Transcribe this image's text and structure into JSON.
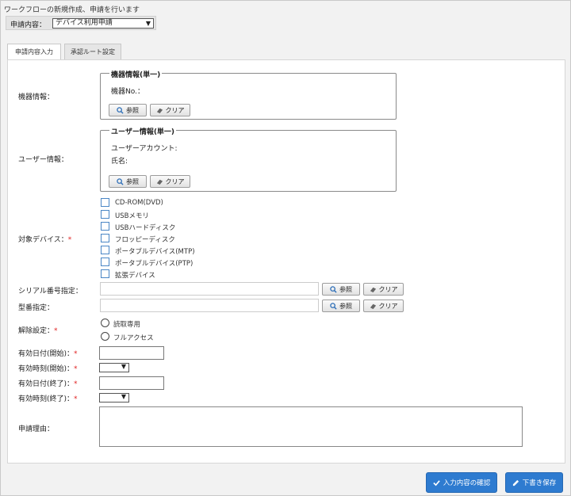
{
  "page": {
    "description": "ワークフローの新規作成、申請を行います",
    "request_type_label": "申請内容：",
    "request_type_value": "デバイス利用申請"
  },
  "tabs": [
    {
      "label": "申請内容入力",
      "active": true
    },
    {
      "label": "承認ルート設定",
      "active": false
    }
  ],
  "device_info": {
    "row_label": "機器情報：",
    "group_title": "機器情報(単一)",
    "field_label": "機器No.：",
    "ref_label": "参照",
    "clear_label": "クリア"
  },
  "user_info": {
    "row_label": "ユーザー情報：",
    "group_title": "ユーザー情報(単一)",
    "account_label": "ユーザーアカウント:",
    "name_label": "氏名:",
    "ref_label": "参照",
    "clear_label": "クリア"
  },
  "target_device": {
    "label": "対象デバイス：",
    "required_mark": "*",
    "options": [
      {
        "label": "CD-ROM(DVD)",
        "checked": false
      },
      {
        "label": "USBメモリ",
        "checked": false
      },
      {
        "label": "USBハードディスク",
        "checked": false
      },
      {
        "label": "フロッピーディスク",
        "checked": false
      },
      {
        "label": "ポータブルデバイス(MTP)",
        "checked": false
      },
      {
        "label": "ポータブルデバイス(PTP)",
        "checked": false
      },
      {
        "label": "拡張デバイス",
        "checked": false
      }
    ]
  },
  "serial": {
    "label": "シリアル番号指定：",
    "value": "",
    "ref_label": "参照",
    "clear_label": "クリア"
  },
  "model": {
    "label": "型番指定：",
    "value": "",
    "ref_label": "参照",
    "clear_label": "クリア"
  },
  "release": {
    "label": "解除設定：",
    "required_mark": "*",
    "options": [
      {
        "label": "読取専用",
        "selected": false
      },
      {
        "label": "フルアクセス",
        "selected": false
      }
    ]
  },
  "valid_from_date": {
    "label": "有効日付(開始)：",
    "required_mark": "*",
    "value": ""
  },
  "valid_from_time": {
    "label": "有効時刻(開始)：",
    "required_mark": "*",
    "value": ""
  },
  "valid_to_date": {
    "label": "有効日付(終了)：",
    "required_mark": "*",
    "value": ""
  },
  "valid_to_time": {
    "label": "有効時刻(終了)：",
    "required_mark": "*",
    "value": ""
  },
  "reason": {
    "label": "申請理由：",
    "value": ""
  },
  "actions": {
    "confirm_label": "入力内容の確認",
    "draft_label": "下書き保存"
  },
  "colors": {
    "accent": "#2e7bd0",
    "required": "#e02020",
    "checkbox_border": "#4a86c5"
  }
}
